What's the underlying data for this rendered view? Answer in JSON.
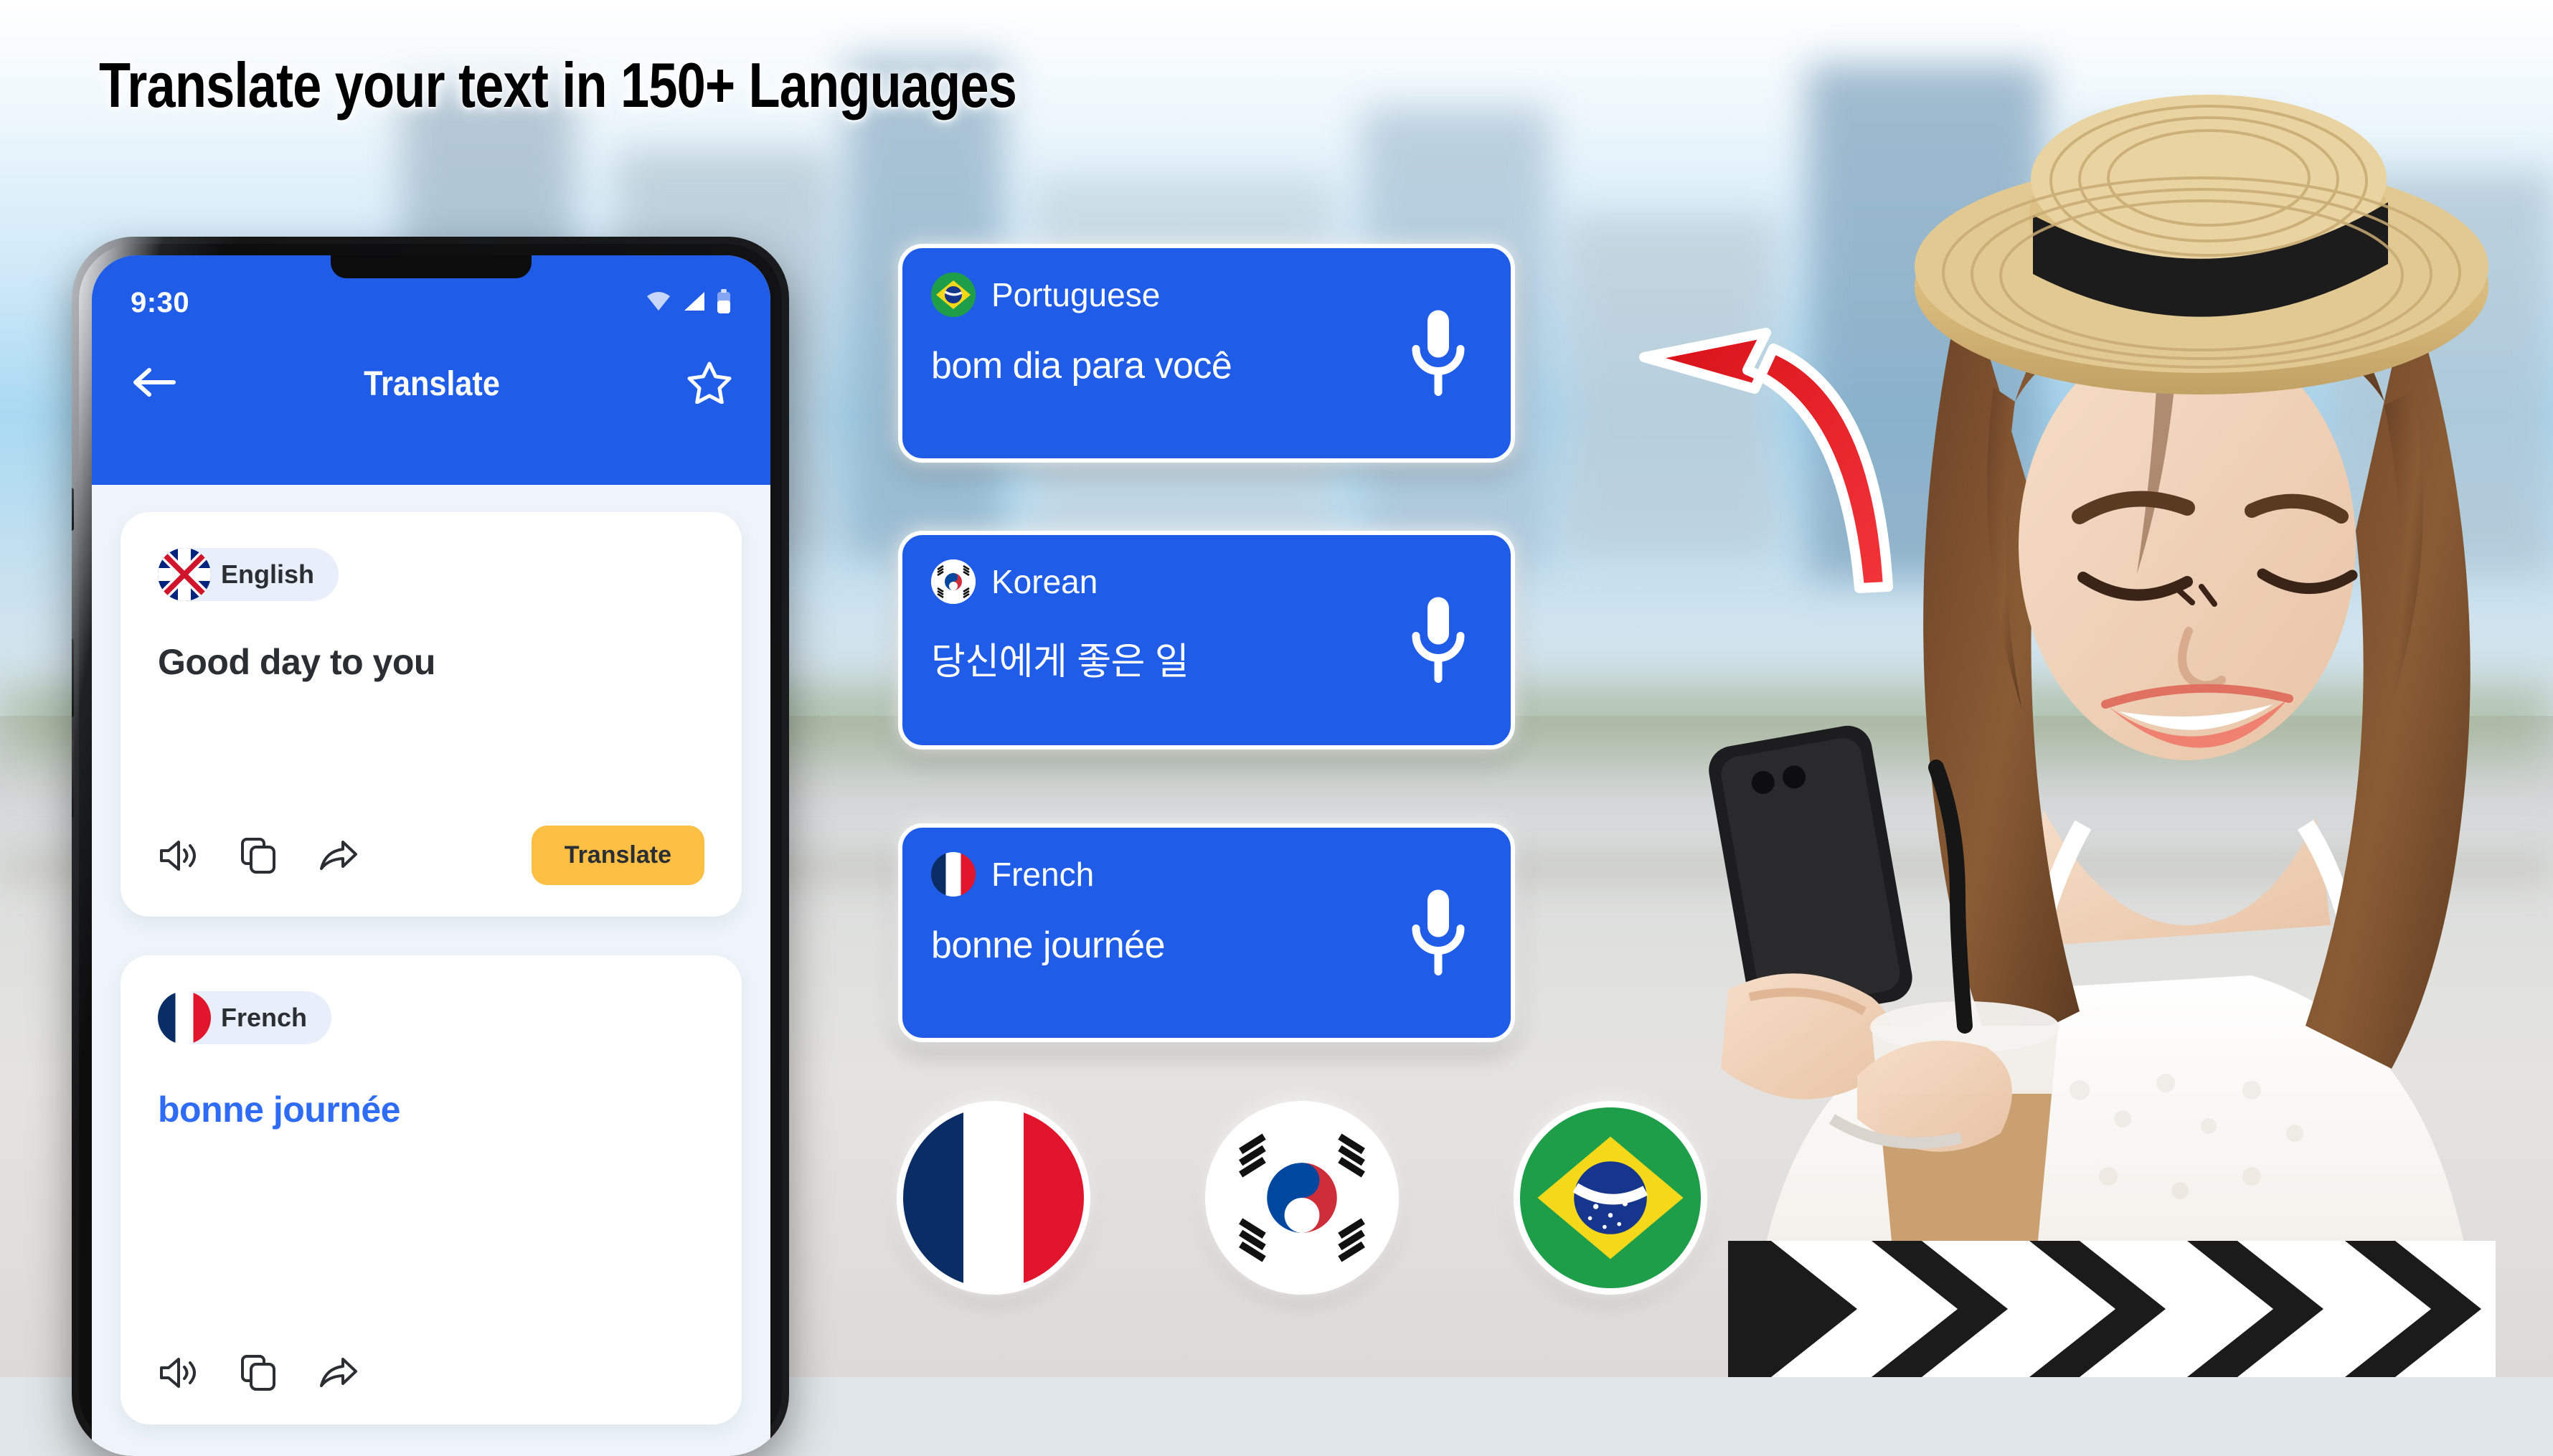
{
  "headline": "Translate your text in 150+ Languages",
  "colors": {
    "brand_blue": "#1F5CE8",
    "accent_amber": "#FBBF43",
    "output_text_blue": "#2F6CF6",
    "arrow_red": "#E8202A",
    "card_white": "#FFFFFF",
    "screen_bg": "#EEF4F9"
  },
  "phone": {
    "status_bar": {
      "time": "9:30",
      "icons": [
        "wifi-icon",
        "signal-icon",
        "battery-icon"
      ]
    },
    "app_bar": {
      "back_icon": "back-arrow-icon",
      "title": "Translate",
      "favorite_icon": "star-icon"
    },
    "source_card": {
      "language": "English",
      "flag": "uk-flag",
      "text": "Good day to you",
      "actions": [
        "speaker-icon",
        "copy-icon",
        "share-icon"
      ],
      "button_label": "Translate"
    },
    "result_card": {
      "language": "French",
      "flag": "france-flag",
      "text": "bonne journée",
      "actions": [
        "speaker-icon",
        "copy-icon",
        "share-icon"
      ]
    }
  },
  "result_cards": [
    {
      "language": "Portuguese",
      "flag": "brazil-flag",
      "text": "bom dia para você",
      "mic_icon": "microphone-icon"
    },
    {
      "language": "Korean",
      "flag": "south-korea-flag",
      "text": "당신에게 좋은 일",
      "mic_icon": "microphone-icon"
    },
    {
      "language": "French",
      "flag": "france-flag",
      "text": "bonne journée",
      "mic_icon": "microphone-icon"
    }
  ],
  "flag_badges": [
    {
      "name": "france-flag-badge",
      "label": "France"
    },
    {
      "name": "south-korea-flag-badge",
      "label": "South Korea"
    },
    {
      "name": "brazil-flag-badge",
      "label": "Brazil"
    }
  ],
  "annotation": {
    "arrow": "curved-red-arrow-pointing-up-left"
  },
  "photo": {
    "subject": "smiling woman in straw hat holding phone and iced coffee"
  }
}
